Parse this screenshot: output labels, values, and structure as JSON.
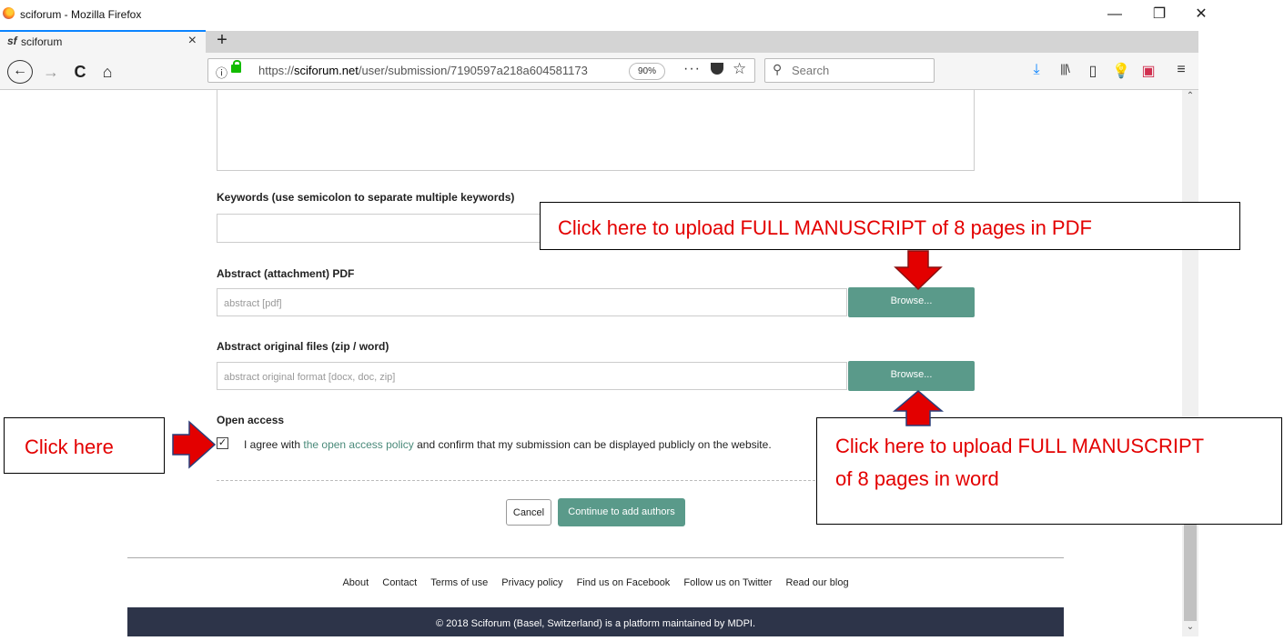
{
  "window": {
    "title": "sciforum - Mozilla Firefox",
    "minimize_glyph": "—",
    "restore_glyph": "❐",
    "close_glyph": "✕"
  },
  "tab": {
    "favicon": "sf",
    "label": "sciforum",
    "close_glyph": "×",
    "new_tab_glyph": "+"
  },
  "nav": {
    "url_prefix": "https://",
    "url_host": "sciforum.net",
    "url_path": "/user/submission/7190597a218a604581173",
    "zoom": "90%",
    "search_placeholder": "Search"
  },
  "form": {
    "keywords_label": "Keywords (use semicolon to separate multiple keywords)",
    "abstract_pdf_label": "Abstract (attachment) PDF",
    "abstract_pdf_placeholder": "abstract [pdf]",
    "abstract_orig_label": "Abstract original files (zip / word)",
    "abstract_orig_placeholder": "abstract original format [docx, doc, zip]",
    "browse_label": "Browse...",
    "open_access_label": "Open access",
    "agree_prefix": "I agree with ",
    "agree_link": "the open access policy",
    "agree_suffix": " and confirm that my submission can be displayed publicly on the website.",
    "checkbox_checked": true,
    "cancel_label": "Cancel",
    "continue_label": "Continue to add authors"
  },
  "footer": {
    "links": [
      "About",
      "Contact",
      "Terms of use",
      "Privacy policy",
      "Find us on Facebook",
      "Follow us on Twitter",
      "Read our blog"
    ],
    "copyright": "© 2018 Sciforum (Basel, Switzerland) is a platform maintained by MDPI."
  },
  "annotations": {
    "pdf_callout": "Click here to upload FULL MANUSCRIPT of 8 pages in PDF",
    "word_callout_line1": "Click here to upload FULL MANUSCRIPT",
    "word_callout_line2": "of 8 pages in word",
    "click_here": "Click here",
    "arrow_color": "#e30000"
  }
}
